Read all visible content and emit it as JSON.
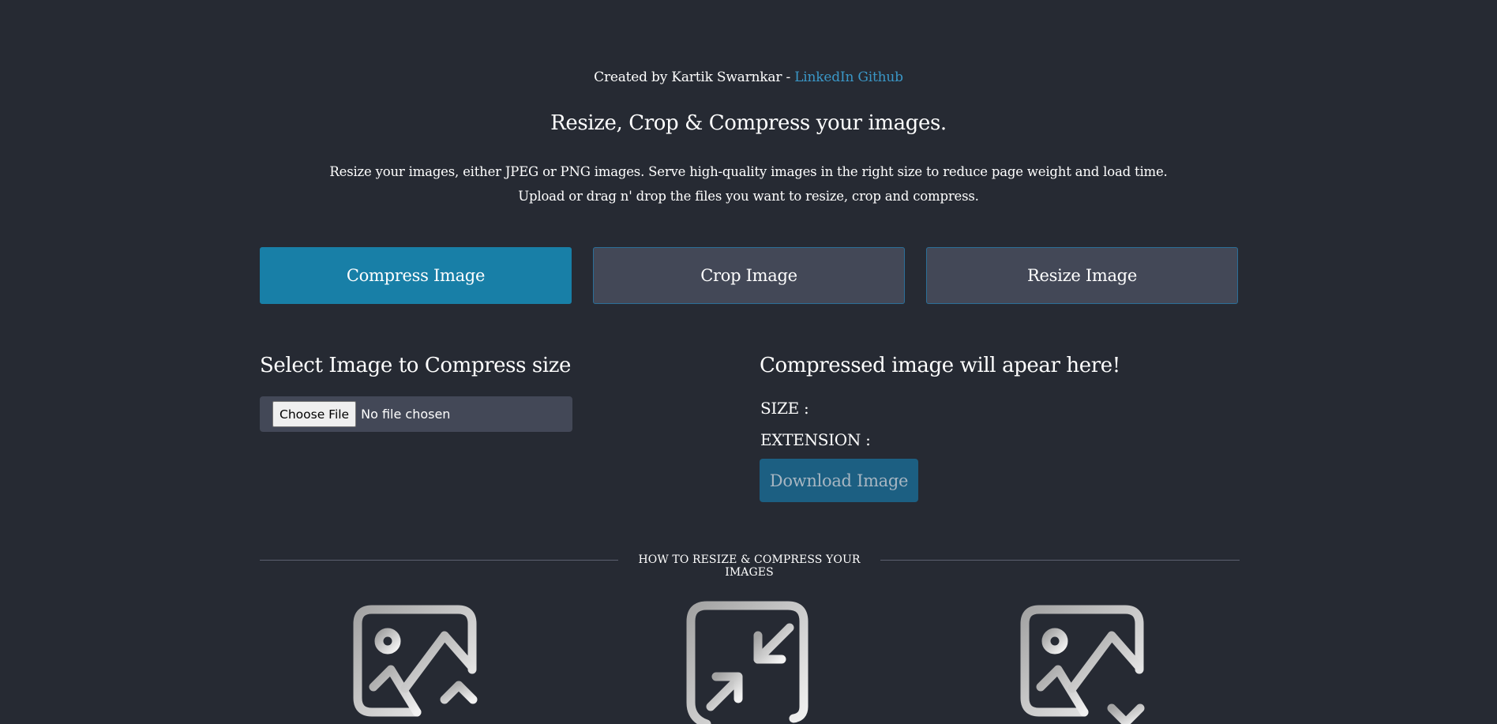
{
  "header": {
    "credit_prefix": "Created by Kartik Swarnkar -",
    "linkedin": "LinkedIn",
    "github": "Github",
    "title": "Resize, Crop & Compress your images.",
    "description_line1": "Resize your images, either JPEG or PNG images. Serve high-quality images in the right size to reduce page weight and load time.",
    "description_line2": "Upload or drag n' drop the files you want to resize, crop and compress."
  },
  "tabs": [
    {
      "label": "Compress Image",
      "active": true
    },
    {
      "label": "Crop Image",
      "active": false
    },
    {
      "label": "Resize Image",
      "active": false
    }
  ],
  "upload": {
    "title": "Select Image to Compress size",
    "choose_button": "Choose File",
    "file_status": "No file chosen"
  },
  "result": {
    "title": "Compressed image will apear here!",
    "size_label": "SIZE :",
    "extension_label": "EXTENSION :",
    "download_button": "Download Image"
  },
  "howto": {
    "heading": "HOW TO RESIZE & COMPRESS YOUR IMAGES",
    "icons": [
      "image-upload-icon",
      "compress-icon",
      "image-download-icon"
    ]
  },
  "colors": {
    "background": "#262a33",
    "accent": "#187fa7",
    "link": "#3a97c7",
    "tab_inactive": "#434857",
    "download_bg": "#1c5f82"
  }
}
